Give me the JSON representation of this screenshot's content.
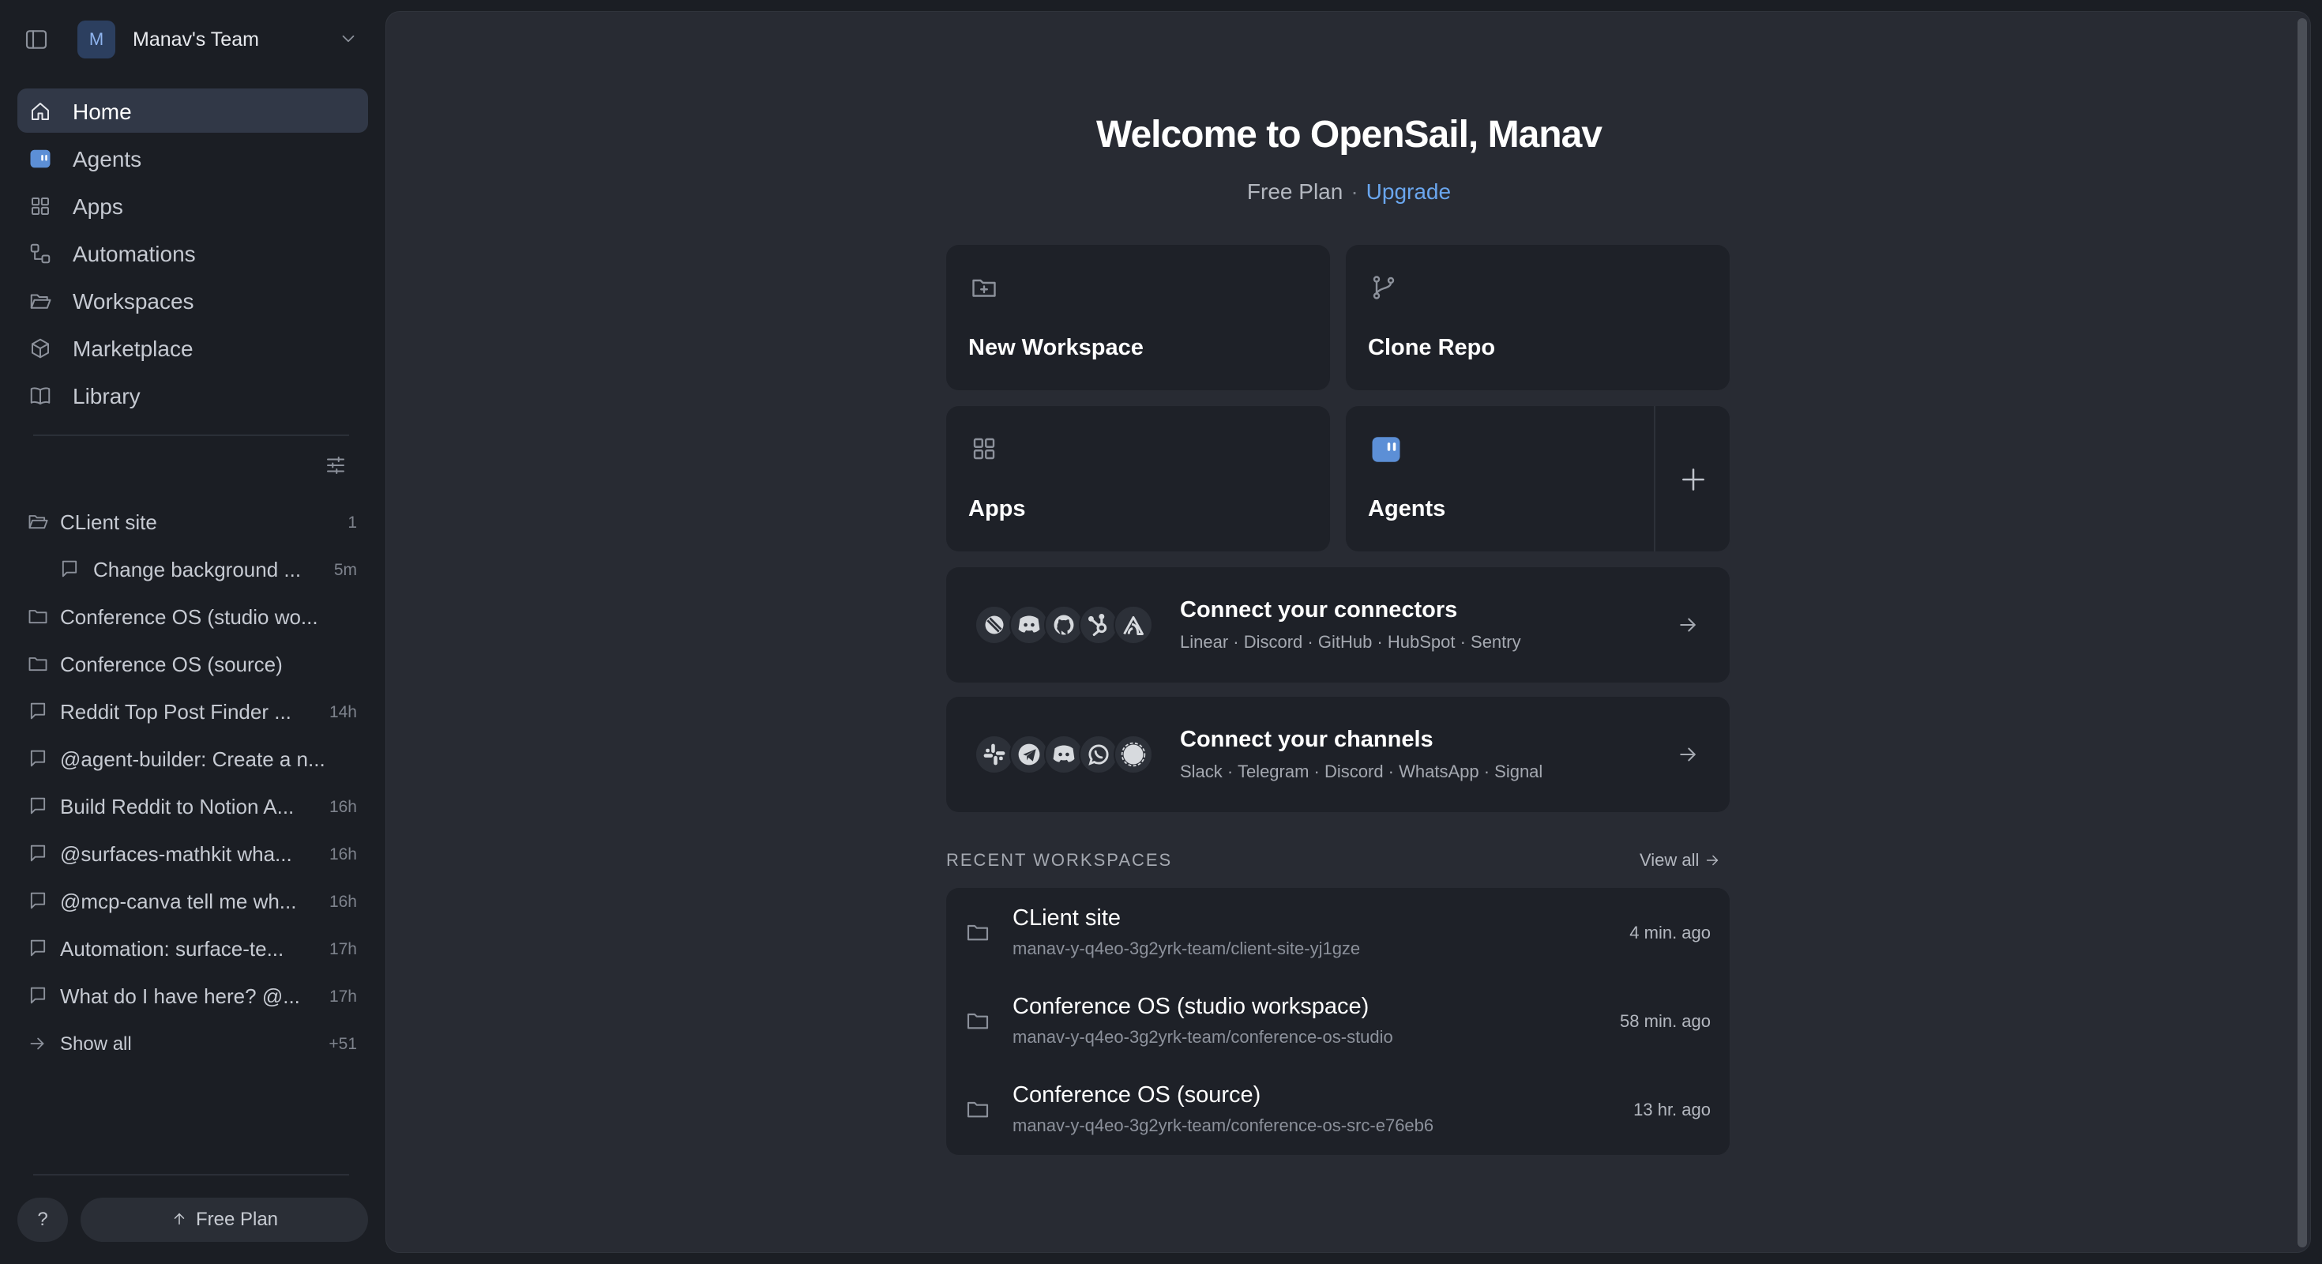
{
  "sidebar": {
    "team": {
      "avatar": "M",
      "name": "Manav's Team"
    },
    "nav": [
      {
        "label": "Home",
        "icon": "home-icon",
        "active": true
      },
      {
        "label": "Agents",
        "icon": "agent-icon"
      },
      {
        "label": "Apps",
        "icon": "grid-icon"
      },
      {
        "label": "Automations",
        "icon": "automation-icon"
      },
      {
        "label": "Workspaces",
        "icon": "folder-open-icon"
      },
      {
        "label": "Marketplace",
        "icon": "box-icon"
      },
      {
        "label": "Library",
        "icon": "book-icon"
      }
    ],
    "recent": [
      {
        "label": "CLient site",
        "meta": "1"
      },
      {
        "label": "Change background ...",
        "meta": "5m"
      },
      {
        "label": "Conference OS (studio wo...",
        "meta": ""
      },
      {
        "label": "Conference OS (source)",
        "meta": ""
      },
      {
        "label": "Reddit Top Post Finder ...",
        "meta": "14h"
      },
      {
        "label": "@agent-builder: Create a n...",
        "meta": ""
      },
      {
        "label": "Build Reddit to Notion A...",
        "meta": "16h"
      },
      {
        "label": "@surfaces-mathkit wha...",
        "meta": "16h"
      },
      {
        "label": "@mcp-canva tell me wh...",
        "meta": "16h"
      },
      {
        "label": "Automation: surface-te...",
        "meta": "17h"
      },
      {
        "label": "What do I have here? @...",
        "meta": "17h"
      }
    ],
    "show_all": {
      "label": "Show all",
      "count": "+51"
    },
    "help_label": "?",
    "free_plan_label": "Free Plan"
  },
  "main": {
    "welcome": "Welcome to OpenSail, Manav",
    "plan": {
      "name": "Free Plan",
      "separator": "·",
      "upgrade": "Upgrade"
    },
    "cards": {
      "new_workspace": "New Workspace",
      "clone_repo": "Clone Repo",
      "apps": "Apps",
      "agents": "Agents"
    },
    "connectors": {
      "title": "Connect your connectors",
      "subtitle": "Linear · Discord · GitHub · HubSpot · Sentry"
    },
    "channels": {
      "title": "Connect your channels",
      "subtitle": "Slack · Telegram · Discord · WhatsApp · Signal"
    },
    "recent_workspaces": {
      "heading": "RECENT WORKSPACES",
      "view_all": "View all",
      "items": [
        {
          "name": "CLient site",
          "path": "manav-y-q4eo-3g2yrk-team/client-site-yj1gze",
          "time": "4 min. ago"
        },
        {
          "name": "Conference OS (studio workspace)",
          "path": "manav-y-q4eo-3g2yrk-team/conference-os-studio",
          "time": "58 min. ago"
        },
        {
          "name": "Conference OS (source)",
          "path": "manav-y-q4eo-3g2yrk-team/conference-os-src-e76eb6",
          "time": "13 hr. ago"
        }
      ]
    }
  },
  "colors": {
    "accent": "#6aa6ee",
    "active_nav": "#313847",
    "panel": "#282b33",
    "card": "#1e2128",
    "sidebar": "#1b1e24"
  }
}
